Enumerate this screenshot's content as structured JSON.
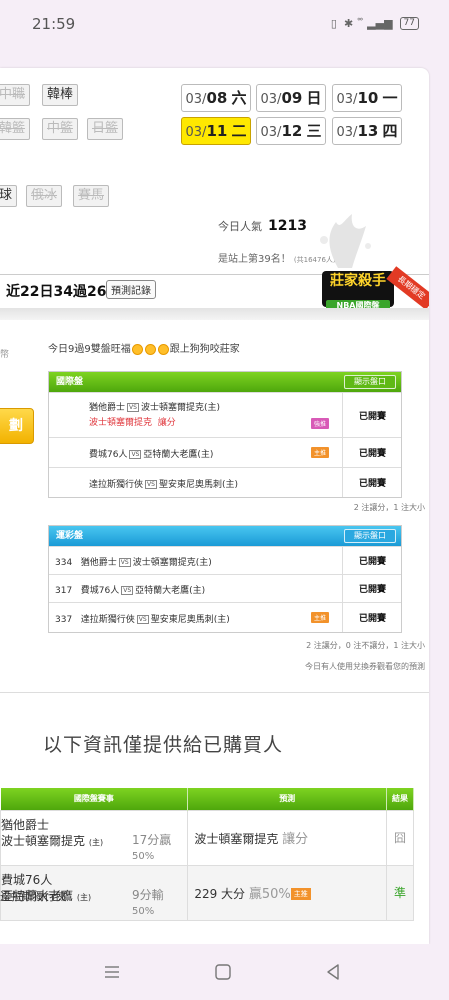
{
  "status_bar": {
    "time": "21:59",
    "icons": [
      "vibrate-icon",
      "bluetooth-icon",
      "volte-icon",
      "signal-4g-icon"
    ],
    "battery": "77"
  },
  "sports_tags": {
    "row1": [
      {
        "label": "中職",
        "disabled": true
      },
      {
        "label": "韓棒",
        "disabled": false
      }
    ],
    "row2": [
      {
        "label": "韓籃",
        "disabled": true
      },
      {
        "label": "中籃",
        "disabled": true
      },
      {
        "label": "日籃",
        "disabled": true
      }
    ],
    "row3": [
      {
        "label": "球",
        "disabled": false
      },
      {
        "label": "俄冰",
        "disabled": true
      },
      {
        "label": "賽馬",
        "disabled": true
      }
    ]
  },
  "dates": [
    {
      "md": "03/",
      "d": "08",
      "w": "六",
      "active": false
    },
    {
      "md": "03/",
      "d": "09",
      "w": "日",
      "active": false
    },
    {
      "md": "03/",
      "d": "10",
      "w": "一",
      "active": false
    },
    {
      "md": "03/",
      "d": "11",
      "w": "二",
      "active": true
    },
    {
      "md": "03/",
      "d": "12",
      "w": "三",
      "active": false
    },
    {
      "md": "03/",
      "d": "13",
      "w": "四",
      "active": false
    }
  ],
  "popularity": {
    "label": "今日人氣",
    "value": "1213"
  },
  "rank": {
    "text": "是站上第39名！",
    "sub": "(共16476人)"
  },
  "record": {
    "text": "近22日34過26",
    "button": "預測記錄"
  },
  "badge": {
    "title": "莊家殺手",
    "sub": "NBA國際盤",
    "ribbon": "長期穩定"
  },
  "side": {
    "label": "幣",
    "button": "劃"
  },
  "headline": {
    "before": "今日9過9雙盤旺福",
    "after": "跟上狗狗咬莊家"
  },
  "intl_panel": {
    "title": "國際盤",
    "button": "顯示盤口",
    "rows": [
      {
        "away": "猶他爵士",
        "vs": "VS",
        "home": "波士頓塞爾提克(主)",
        "pick": "波士頓塞爾提克",
        "pick_type": "讓分",
        "mark": "強推",
        "status": "已開賽"
      },
      {
        "away": "費城76人",
        "vs": "VS",
        "home": "亞特蘭大老鷹(主)",
        "mark": "主推",
        "status": "已開賽"
      },
      {
        "away": "達拉斯獨行俠",
        "vs": "VS",
        "home": "聖安東尼奧馬刺(主)",
        "status": "已開賽"
      }
    ],
    "footnote": "2 注讓分，1 注大小"
  },
  "lottery_panel": {
    "title": "運彩盤",
    "button": "顯示盤口",
    "rows": [
      {
        "num": "334",
        "away": "猶他爵士",
        "vs": "VS",
        "home": "波士頓塞爾提克(主)",
        "status": "已開賽"
      },
      {
        "num": "317",
        "away": "費城76人",
        "vs": "VS",
        "home": "亞特蘭大老鷹(主)",
        "status": "已開賽"
      },
      {
        "num": "337",
        "away": "達拉斯獨行俠",
        "vs": "VS",
        "home": "聖安東尼奧馬刺(主)",
        "mark": "主推",
        "status": "已開賽"
      }
    ],
    "footnote": "2 注讓分，0 注不讓分，1 注大小",
    "footnote2": "今日有人使用兌換券觀看您的預測"
  },
  "info_title": "以下資訊僅提供給已購買人",
  "bottom_table": {
    "headers": [
      "國際盤賽事",
      "預測",
      "結果"
    ],
    "rows": [
      {
        "away": "猶他爵士",
        "home": "波士頓塞爾提克",
        "home_tag": "(主)",
        "odds_a": "17分贏",
        "odds_b": "50%",
        "pred_main": "波士頓塞爾提克",
        "pred_sub": "讓分",
        "pred_mark": "",
        "result": "囧"
      },
      {
        "away": "費城76人",
        "home": "亞特蘭大老鷹",
        "home_tag": "(主)",
        "odds_a": "9分輸",
        "odds_b": "50%",
        "pred_main": "229 大分",
        "pred_sub": "贏50%",
        "pred_mark": "主推",
        "result": "準"
      }
    ],
    "partial": "達拉斯獨行俠"
  }
}
